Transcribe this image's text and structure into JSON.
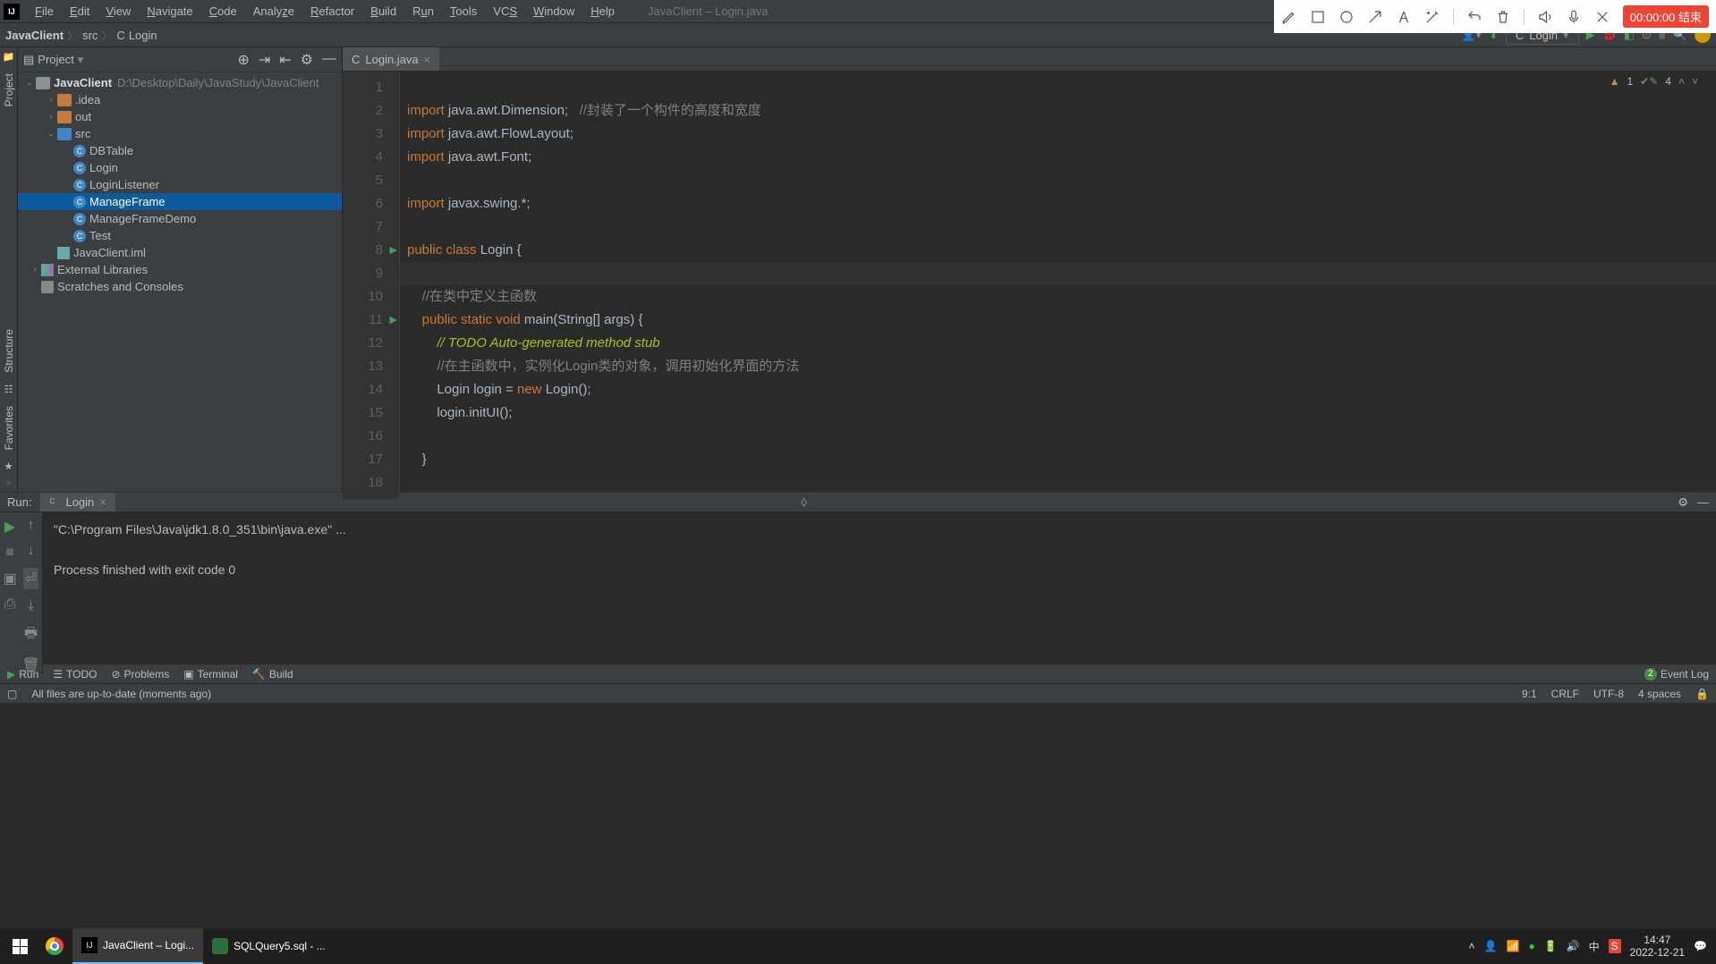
{
  "recorder": {
    "timer": "00:00:00 结束"
  },
  "menu": {
    "items": [
      "File",
      "Edit",
      "View",
      "Navigate",
      "Code",
      "Analyze",
      "Refactor",
      "Build",
      "Run",
      "Tools",
      "VCS",
      "Window",
      "Help"
    ],
    "window_title": "JavaClient – Login.java"
  },
  "breadcrumb": {
    "items": [
      "JavaClient",
      "src",
      "Login"
    ]
  },
  "run_config": {
    "label": "Login"
  },
  "project_panel": {
    "title": "Project",
    "root": {
      "name": "JavaClient",
      "path": "D:\\Desktop\\Daily\\JavaStudy\\JavaClient"
    },
    "folders": {
      "idea": ".idea",
      "out": "out",
      "src": "src"
    },
    "src_files": [
      "DBTable",
      "Login",
      "LoginListener",
      "ManageFrame",
      "ManageFrameDemo",
      "Test"
    ],
    "iml": "JavaClient.iml",
    "external": "External Libraries",
    "scratches": "Scratches and Consoles"
  },
  "editor": {
    "tab": "Login.java",
    "warnings": "1",
    "oks": "4",
    "lines": [
      "",
      "<kw>import</kw> java.awt.Dimension;   <com>//封装了一个构件的高度和宽度</com>",
      "<kw>import</kw> java.awt.FlowLayout;",
      "<kw>import</kw> java.awt.Font;",
      "",
      "<kw>import</kw> javax.swing.*;",
      "",
      "<kw>public class</kw> Login {",
      "",
      "    <com>//在类中定义主函数</com>",
      "    <kw>public static void</kw> main(String[] args) {",
      "        <todocom>// TODO Auto-generated method stub</todocom>",
      "        <com>//在主函数中，实例化Login类的对象，调用初始化界面的方法</com>",
      "        Login login = <kw>new</kw> Login();",
      "        login.initUI();",
      "",
      "    }",
      ""
    ]
  },
  "run_panel": {
    "label": "Run:",
    "tab": "Login",
    "output_line1": "\"C:\\Program Files\\Java\\jdk1.8.0_351\\bin\\java.exe\" ...",
    "output_line2": "Process finished with exit code 0"
  },
  "bottom_tabs": {
    "run": "Run",
    "todo": "TODO",
    "problems": "Problems",
    "terminal": "Terminal",
    "build": "Build",
    "event_log": "Event Log",
    "event_badge": "2"
  },
  "status_footer": {
    "msg": "All files are up-to-date (moments ago)",
    "pos": "9:1",
    "eol": "CRLF",
    "enc": "UTF-8",
    "indent": "4 spaces"
  },
  "taskbar": {
    "app1": "JavaClient – Logi...",
    "app2": "SQLQuery5.sql - ...",
    "ime": "中",
    "time": "14:47",
    "date": "2022-12-21"
  },
  "sidebar_tabs": {
    "project": "Project",
    "structure": "Structure",
    "favorites": "Favorites"
  }
}
